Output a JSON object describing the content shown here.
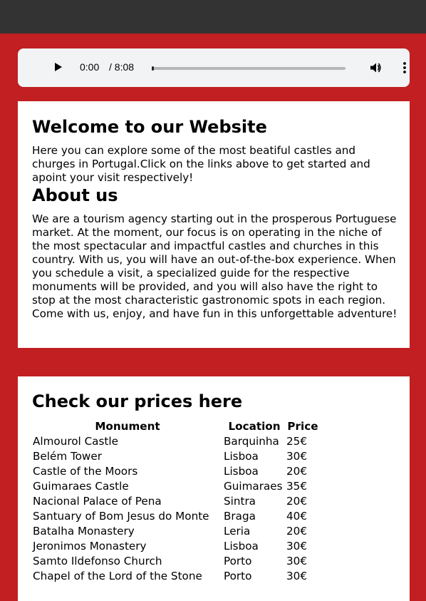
{
  "audio_player": {
    "current_time": "0:00",
    "total_time": "/ 8:08"
  },
  "welcome": {
    "heading": "Welcome to our Website",
    "text": "Here you can explore some of the most beatiful castles and churges in Portugal.Click on the links above to get started and apoint your visit respectively!"
  },
  "about": {
    "heading": "About us",
    "text": "We are a tourism agency starting out in the prosperous Portuguese market. At the moment, our focus is on operating in the niche of the most spectacular and impactful castles and churches in this country. With us, you will have an out-of-the-box experience. When you schedule a visit, a specialized guide for the respective monuments will be provided, and you will also have the right to stop at the most characteristic gastronomic spots in each region. Come with us, enjoy, and have fun in this unforgettable adventure!"
  },
  "prices": {
    "heading": "Check our prices here",
    "columns": [
      "Monument",
      "Location",
      "Price"
    ],
    "rows": [
      [
        "Almourol Castle",
        "Barquinha",
        "25€"
      ],
      [
        "Belém Tower",
        "Lisboa",
        "30€"
      ],
      [
        "Castle of the Moors",
        "Lisboa",
        "20€"
      ],
      [
        "Guimaraes Castle",
        "Guimaraes",
        "35€"
      ],
      [
        "Nacional Palace of Pena",
        "Sintra",
        "20€"
      ],
      [
        "Santuary of Bom Jesus do Monte",
        "Braga",
        "40€"
      ],
      [
        "Batalha Monastery",
        "Leria",
        "20€"
      ],
      [
        "Jeronimos Monastery",
        "Lisboa",
        "30€"
      ],
      [
        "Samto Ildefonso Church",
        "Porto",
        "30€"
      ],
      [
        "Chapel of the Lord of the Stone",
        "Porto",
        "30€"
      ]
    ]
  },
  "colors": {
    "background": "#c11f21",
    "topbar": "#333333",
    "panel": "#ffffff",
    "player": "#f1f3f4"
  }
}
